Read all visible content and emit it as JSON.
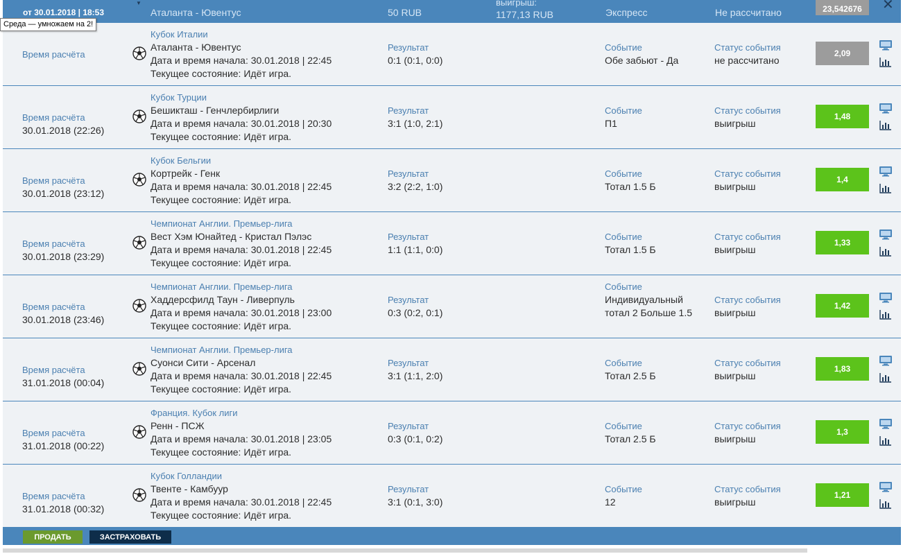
{
  "tooltip": "Среда — умножаем на 2!",
  "header": {
    "date": "от 30.01.2018 | 18:53",
    "match": "Аталанта - Ювентус",
    "stake": "50 RUB",
    "win_label": "выигрыш:",
    "win_value": "1177,13 RUB",
    "bet_type": "Экспресс",
    "status": "Не рассчитано",
    "total_odd": "23,542676"
  },
  "labels": {
    "calc_time": "Время расчёта",
    "result": "Результат",
    "event": "Событие",
    "event_status": "Статус события"
  },
  "rows": [
    {
      "calc_time": "",
      "league": "Кубок Италии",
      "match": "Аталанта - Ювентус",
      "start": "Дата и время начала: 30.01.2018 | 22:45",
      "state": "Текущее состояние: Идёт игра.",
      "result": "0:1 (0:1, 0:0)",
      "event_line1": "Обе забьют - Да",
      "event_line2": "",
      "status": "не рассчитано",
      "odd": "2,09",
      "odd_state": "pending"
    },
    {
      "calc_time": "30.01.2018 (22:26)",
      "league": "Кубок Турции",
      "match": "Бешикташ - Генчлербирлиги",
      "start": "Дата и время начала: 30.01.2018 | 20:30",
      "state": "Текущее состояние: Идёт игра.",
      "result": "3:1 (1:0, 2:1)",
      "event_line1": "П1",
      "event_line2": "",
      "status": "выигрыш",
      "odd": "1,48",
      "odd_state": "win"
    },
    {
      "calc_time": "30.01.2018 (23:12)",
      "league": "Кубок Бельгии",
      "match": "Кортрейк - Генк",
      "start": "Дата и время начала: 30.01.2018 | 22:45",
      "state": "Текущее состояние: Идёт игра.",
      "result": "3:2 (2:2, 1:0)",
      "event_line1": "Тотал 1.5 Б",
      "event_line2": "",
      "status": "выигрыш",
      "odd": "1,4",
      "odd_state": "win"
    },
    {
      "calc_time": "30.01.2018 (23:29)",
      "league": "Чемпионат Англии. Премьер-лига",
      "match": "Вест Хэм Юнайтед - Кристал Пэлэс",
      "start": "Дата и время начала: 30.01.2018 | 22:45",
      "state": "Текущее состояние: Идёт игра.",
      "result": "1:1 (1:1, 0:0)",
      "event_line1": "Тотал 1.5 Б",
      "event_line2": "",
      "status": "выигрыш",
      "odd": "1,33",
      "odd_state": "win"
    },
    {
      "calc_time": "30.01.2018 (23:46)",
      "league": "Чемпионат Англии. Премьер-лига",
      "match": "Хаддерсфилд Таун - Ливерпуль",
      "start": "Дата и время начала: 30.01.2018 | 23:00",
      "state": "Текущее состояние: Идёт игра.",
      "result": "0:3 (0:2, 0:1)",
      "event_line1": "Индивидуальный",
      "event_line2": "тотал 2 Больше 1.5",
      "status": "выигрыш",
      "odd": "1,42",
      "odd_state": "win"
    },
    {
      "calc_time": "31.01.2018 (00:04)",
      "league": "Чемпионат Англии. Премьер-лига",
      "match": "Суонси Сити - Арсенал",
      "start": "Дата и время начала: 30.01.2018 | 22:45",
      "state": "Текущее состояние: Идёт игра.",
      "result": "3:1 (1:1, 2:0)",
      "event_line1": "Тотал 2.5 Б",
      "event_line2": "",
      "status": "выигрыш",
      "odd": "1,83",
      "odd_state": "win"
    },
    {
      "calc_time": "31.01.2018 (00:22)",
      "league": "Франция. Кубок лиги",
      "match": "Ренн - ПСЖ",
      "start": "Дата и время начала: 30.01.2018 | 23:05",
      "state": "Текущее состояние: Идёт игра.",
      "result": "0:3 (0:1, 0:2)",
      "event_line1": "Тотал 2.5 Б",
      "event_line2": "",
      "status": "выигрыш",
      "odd": "1,3",
      "odd_state": "win"
    },
    {
      "calc_time": "31.01.2018 (00:32)",
      "league": "Кубок Голландии",
      "match": "Твенте - Камбуур",
      "start": "Дата и время начала: 30.01.2018 | 22:45",
      "state": "Текущее состояние: Идёт игра.",
      "result": "3:1 (0:1, 3:0)",
      "event_line1": "12",
      "event_line2": "",
      "status": "выигрыш",
      "odd": "1,21",
      "odd_state": "win"
    }
  ],
  "footer": {
    "sell_label": "ПРОДАТЬ",
    "insure_label": "ЗАСТРАХОВАТЬ"
  },
  "colors": {
    "frame": "#4a86bb",
    "row_bg": "#eff2f5",
    "win": "#5cc31b",
    "pending": "#9c9c9c",
    "label": "#4a7fb0"
  }
}
